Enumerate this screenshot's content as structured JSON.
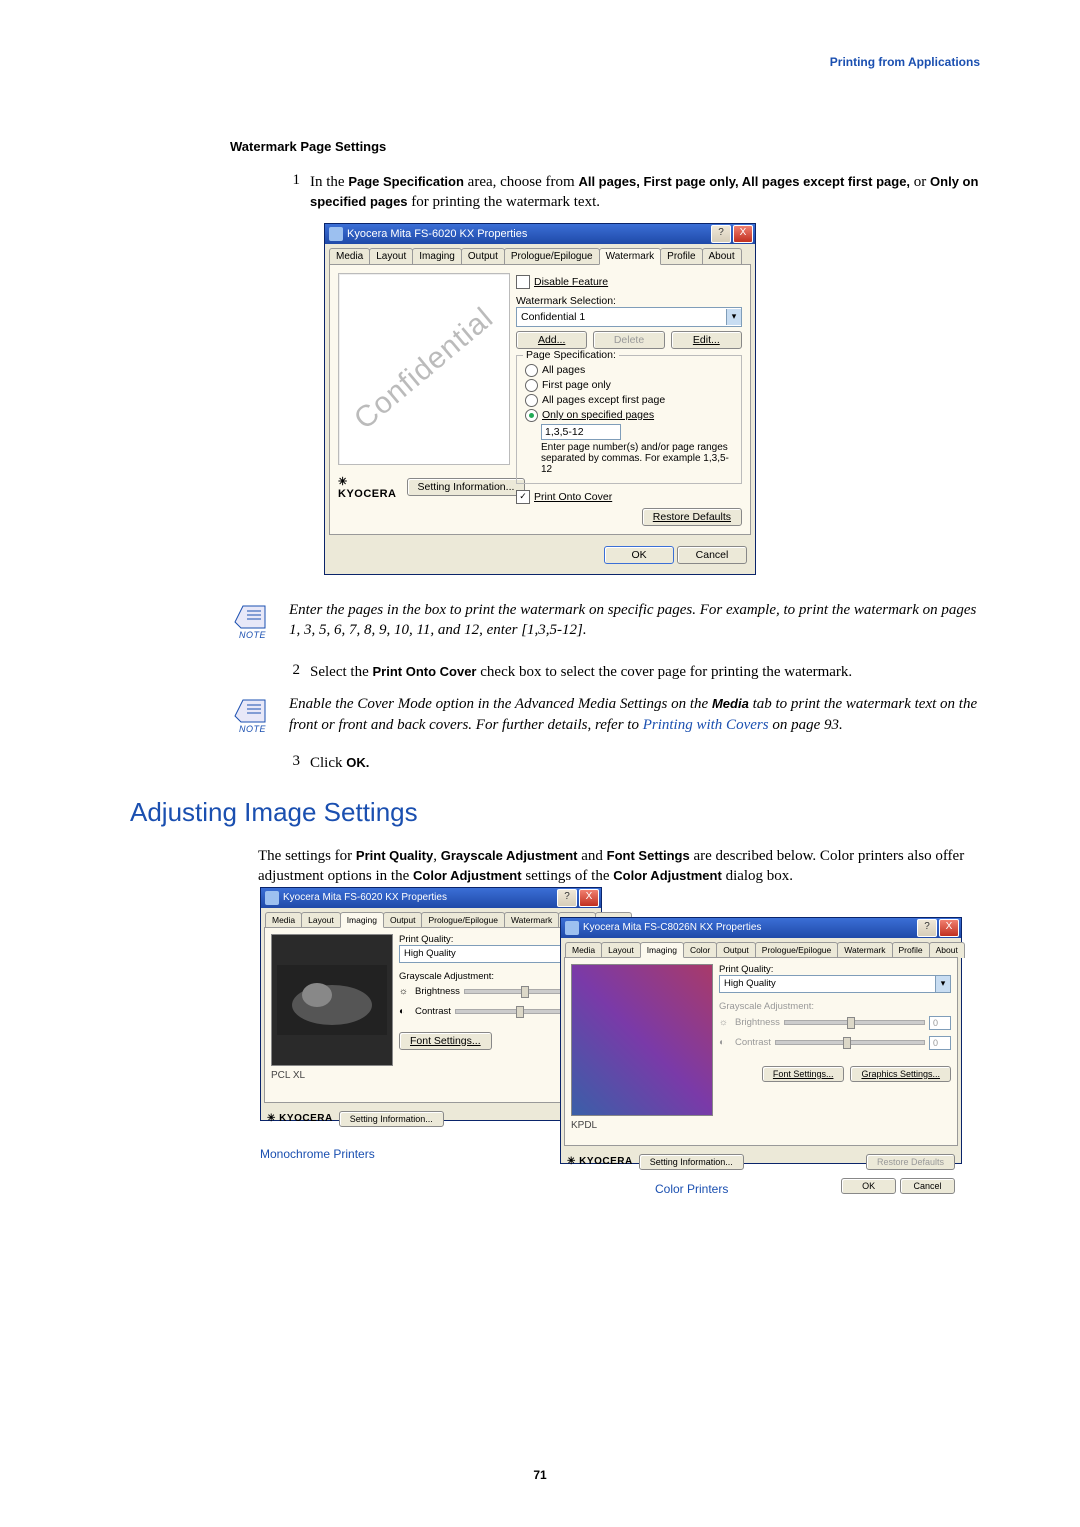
{
  "header": {
    "breadcrumb": "Printing from Applications"
  },
  "section1": {
    "title": "Watermark Page Settings",
    "step1_pre": "In the ",
    "step1_b1": "Page Specification",
    "step1_mid1": " area, choose from ",
    "step1_b2": "All pages, First page only, All pages except first page,",
    "step1_mid2": " or ",
    "step1_b3": "Only on specified pages",
    "step1_post": " for printing the watermark text."
  },
  "dlg1": {
    "title": "Kyocera Mita FS-6020 KX Properties",
    "tabs": [
      "Media",
      "Layout",
      "Imaging",
      "Output",
      "Prologue/Epilogue",
      "Watermark",
      "Profile",
      "About"
    ],
    "active_tab": "Watermark",
    "preview_watermark_text": "Confidential",
    "brand": "KYOCERA",
    "setting_info_btn": "Setting Information...",
    "disable_feature": "Disable Feature",
    "wm_selection_label": "Watermark Selection:",
    "wm_selection_value": "Confidential 1",
    "add_btn": "Add...",
    "delete_btn": "Delete",
    "edit_btn": "Edit...",
    "page_spec_label": "Page Specification:",
    "radio_all": "All pages",
    "radio_first": "First page only",
    "radio_except": "All pages except first page",
    "radio_only": "Only on specified pages",
    "pages_value": "1,3,5-12",
    "pages_hint": "Enter page number(s) and/or page ranges separated by commas. For example 1,3,5-12",
    "print_onto_cover": "Print Onto Cover",
    "restore_defaults": "Restore Defaults",
    "ok": "OK",
    "cancel": "Cancel",
    "help": "?",
    "close": "X"
  },
  "note1": {
    "label": "NOTE",
    "text": "Enter the pages in the box to print the watermark on specific pages. For example, to print the watermark on pages 1, 3, 5, 6, 7, 8, 9, 10, 11, and 12, enter [1,3,5-12]."
  },
  "step2": {
    "num": "2",
    "pre": "Select the ",
    "b1": "Print Onto Cover",
    "post": " check box to select the cover page for printing the watermark."
  },
  "note2": {
    "label": "NOTE",
    "line1a": "Enable the Cover Mode option in the Advanced Media Settings on the ",
    "line1b": "Media",
    "line1c": " tab to print the watermark text on the front or front and back covers. For further details, refer to ",
    "link": "Printing with Covers",
    "line1d": " on page 93."
  },
  "step3": {
    "num": "3",
    "pre": "Click ",
    "b1": "OK."
  },
  "h1": "Adjusting Image Settings",
  "intro": {
    "p1a": "The settings for ",
    "p1b": "Print Quality",
    "p1c": ", ",
    "p1d": "Grayscale Adjustment",
    "p1e": " and ",
    "p1f": "Font Settings",
    "p1g": " are described below. Color printers also offer adjustment options in the ",
    "p1h": "Color Adjustment",
    "p1i": " settings of the ",
    "p1j": "Color Adjustment",
    "p1k": " dialog box."
  },
  "dlg_mono": {
    "title": "Kyocera Mita FS-6020 KX Properties",
    "tabs": [
      "Media",
      "Layout",
      "Imaging",
      "Output",
      "Prologue/Epilogue",
      "Watermark",
      "Profile",
      "About"
    ],
    "active_tab": "Imaging",
    "print_quality_label": "Print Quality:",
    "print_quality_value": "High Quality",
    "grayscale_label": "Grayscale Adjustment:",
    "brightness": "Brightness",
    "contrast": "Contrast",
    "font_settings": "Font Settings...",
    "pcl": "PCL XL",
    "brand": "KYOCERA",
    "setting_info_btn": "Setting Information..."
  },
  "dlg_color": {
    "title": "Kyocera Mita FS-C8026N KX Properties",
    "tabs": [
      "Media",
      "Layout",
      "Imaging",
      "Color",
      "Output",
      "Prologue/Epilogue",
      "Watermark",
      "Profile",
      "About"
    ],
    "active_tab": "Imaging",
    "print_quality_label": "Print Quality:",
    "print_quality_value": "High Quality",
    "grayscale_label": "Grayscale Adjustment:",
    "brightness": "Brightness",
    "contrast": "Contrast",
    "zero": "0",
    "font_settings": "Font Settings...",
    "graphics_settings": "Graphics Settings...",
    "kpdl": "KPDL",
    "brand": "KYOCERA",
    "setting_info_btn": "Setting Information...",
    "restore_defaults": "Restore Defaults",
    "ok": "OK",
    "cancel": "Cancel"
  },
  "captions": {
    "mono": "Monochrome Printers",
    "color": "Color Printers"
  },
  "page_number": "71"
}
